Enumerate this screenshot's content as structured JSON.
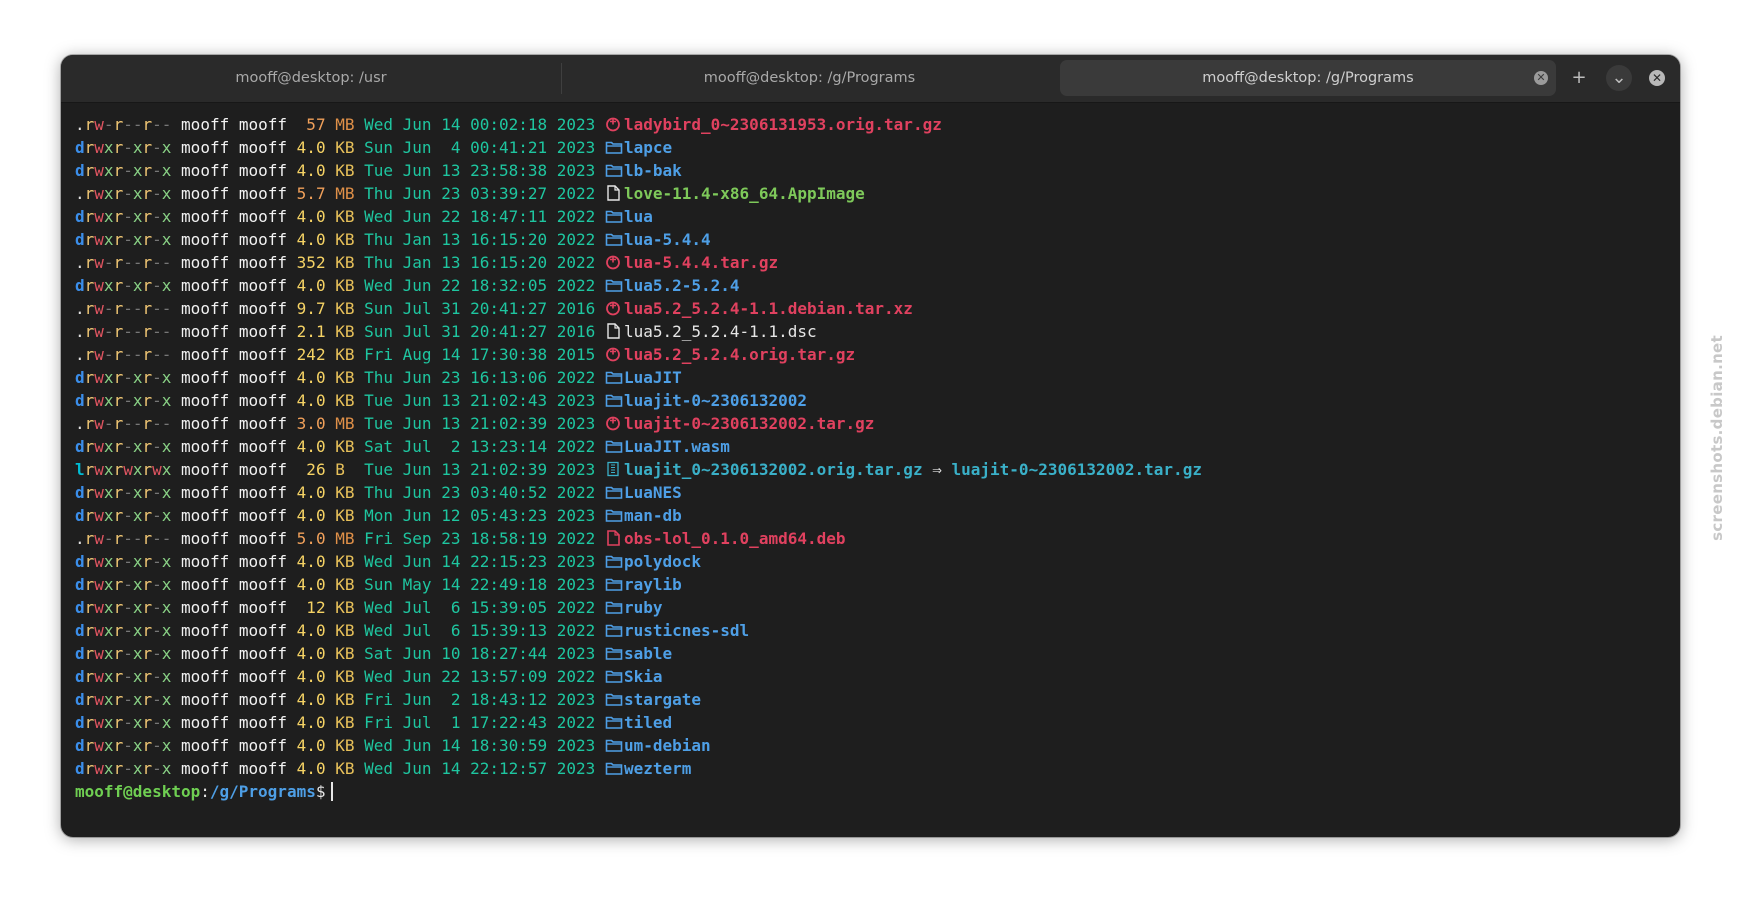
{
  "tabs": [
    {
      "label": "mooff@desktop: /usr"
    },
    {
      "label": "mooff@desktop: /g/Programs"
    },
    {
      "label": "mooff@desktop: /g/Programs"
    }
  ],
  "controls": {
    "add": "+",
    "menu": "⌄",
    "close": "✕",
    "tab_close": "✕"
  },
  "entries": [
    {
      "perm": ".rw-r--r--",
      "user": "mooff",
      "group": "mooff",
      "size": "57",
      "unit": "MB",
      "date": "Wed Jun 14 00:02:18 2023",
      "icon": "archive-icon",
      "name": "ladybird_0~2306131953.orig.tar.gz",
      "kind": "arch"
    },
    {
      "perm": "drwxr-xr-x",
      "user": "mooff",
      "group": "mooff",
      "size": "4.0",
      "unit": "KB",
      "date": "Sun Jun  4 00:41:21 2023",
      "icon": "folder-icon",
      "name": "lapce",
      "kind": "dir"
    },
    {
      "perm": "drwxr-xr-x",
      "user": "mooff",
      "group": "mooff",
      "size": "4.0",
      "unit": "KB",
      "date": "Tue Jun 13 23:58:38 2023",
      "icon": "folder-icon",
      "name": "lb-bak",
      "kind": "dir"
    },
    {
      "perm": ".rwxr-xr-x",
      "user": "mooff",
      "group": "mooff",
      "size": "5.7",
      "unit": "MB",
      "date": "Thu Jun 23 03:39:27 2022",
      "icon": "file-icon",
      "name": "love-11.4-x86_64.AppImage",
      "kind": "exec"
    },
    {
      "perm": "drwxr-xr-x",
      "user": "mooff",
      "group": "mooff",
      "size": "4.0",
      "unit": "KB",
      "date": "Wed Jun 22 18:47:11 2022",
      "icon": "folder-icon",
      "name": "lua",
      "kind": "dir"
    },
    {
      "perm": "drwxr-xr-x",
      "user": "mooff",
      "group": "mooff",
      "size": "4.0",
      "unit": "KB",
      "date": "Thu Jan 13 16:15:20 2022",
      "icon": "folder-icon",
      "name": "lua-5.4.4",
      "kind": "dir"
    },
    {
      "perm": ".rw-r--r--",
      "user": "mooff",
      "group": "mooff",
      "size": "352",
      "unit": "KB",
      "date": "Thu Jan 13 16:15:20 2022",
      "icon": "archive-icon",
      "name": "lua-5.4.4.tar.gz",
      "kind": "arch"
    },
    {
      "perm": "drwxr-xr-x",
      "user": "mooff",
      "group": "mooff",
      "size": "4.0",
      "unit": "KB",
      "date": "Wed Jun 22 18:32:05 2022",
      "icon": "folder-icon",
      "name": "lua5.2-5.2.4",
      "kind": "dir"
    },
    {
      "perm": ".rw-r--r--",
      "user": "mooff",
      "group": "mooff",
      "size": "9.7",
      "unit": "KB",
      "date": "Sun Jul 31 20:41:27 2016",
      "icon": "archive-icon",
      "name": "lua5.2_5.2.4-1.1.debian.tar.xz",
      "kind": "arch"
    },
    {
      "perm": ".rw-r--r--",
      "user": "mooff",
      "group": "mooff",
      "size": "2.1",
      "unit": "KB",
      "date": "Sun Jul 31 20:41:27 2016",
      "icon": "file-icon",
      "name": "lua5.2_5.2.4-1.1.dsc",
      "kind": "file"
    },
    {
      "perm": ".rw-r--r--",
      "user": "mooff",
      "group": "mooff",
      "size": "242",
      "unit": "KB",
      "date": "Fri Aug 14 17:30:38 2015",
      "icon": "archive-icon",
      "name": "lua5.2_5.2.4.orig.tar.gz",
      "kind": "arch"
    },
    {
      "perm": "drwxr-xr-x",
      "user": "mooff",
      "group": "mooff",
      "size": "4.0",
      "unit": "KB",
      "date": "Thu Jun 23 16:13:06 2022",
      "icon": "folder-icon",
      "name": "LuaJIT",
      "kind": "dir"
    },
    {
      "perm": "drwxr-xr-x",
      "user": "mooff",
      "group": "mooff",
      "size": "4.0",
      "unit": "KB",
      "date": "Tue Jun 13 21:02:43 2023",
      "icon": "folder-icon",
      "name": "luajit-0~2306132002",
      "kind": "dir"
    },
    {
      "perm": ".rw-r--r--",
      "user": "mooff",
      "group": "mooff",
      "size": "3.0",
      "unit": "MB",
      "date": "Tue Jun 13 21:02:39 2023",
      "icon": "archive-icon",
      "name": "luajit-0~2306132002.tar.gz",
      "kind": "arch"
    },
    {
      "perm": "drwxr-xr-x",
      "user": "mooff",
      "group": "mooff",
      "size": "4.0",
      "unit": "KB",
      "date": "Sat Jul  2 13:23:14 2022",
      "icon": "folder-icon",
      "name": "LuaJIT.wasm",
      "kind": "dir"
    },
    {
      "perm": "lrwxrwxrwx",
      "user": "mooff",
      "group": "mooff",
      "size": "26",
      "unit": "B ",
      "date": "Tue Jun 13 21:02:39 2023",
      "icon": "link-icon",
      "name": "luajit_0~2306132002.orig.tar.gz",
      "kind": "link",
      "arrow": "⇒",
      "target": "luajit-0~2306132002.tar.gz"
    },
    {
      "perm": "drwxr-xr-x",
      "user": "mooff",
      "group": "mooff",
      "size": "4.0",
      "unit": "KB",
      "date": "Thu Jun 23 03:40:52 2022",
      "icon": "folder-icon",
      "name": "LuaNES",
      "kind": "dir"
    },
    {
      "perm": "drwxr-xr-x",
      "user": "mooff",
      "group": "mooff",
      "size": "4.0",
      "unit": "KB",
      "date": "Mon Jun 12 05:43:23 2023",
      "icon": "folder-icon",
      "name": "man-db",
      "kind": "dir"
    },
    {
      "perm": ".rw-r--r--",
      "user": "mooff",
      "group": "mooff",
      "size": "5.0",
      "unit": "MB",
      "date": "Fri Sep 23 18:58:19 2022",
      "icon": "deb-icon",
      "name": "obs-lol_0.1.0_amd64.deb",
      "kind": "deb"
    },
    {
      "perm": "drwxr-xr-x",
      "user": "mooff",
      "group": "mooff",
      "size": "4.0",
      "unit": "KB",
      "date": "Wed Jun 14 22:15:23 2023",
      "icon": "folder-icon",
      "name": "polydock",
      "kind": "dir"
    },
    {
      "perm": "drwxr-xr-x",
      "user": "mooff",
      "group": "mooff",
      "size": "4.0",
      "unit": "KB",
      "date": "Sun May 14 22:49:18 2023",
      "icon": "folder-icon",
      "name": "raylib",
      "kind": "dir"
    },
    {
      "perm": "drwxr-xr-x",
      "user": "mooff",
      "group": "mooff",
      "size": "12",
      "unit": "KB",
      "date": "Wed Jul  6 15:39:05 2022",
      "icon": "folder-icon",
      "name": "ruby",
      "kind": "dir"
    },
    {
      "perm": "drwxr-xr-x",
      "user": "mooff",
      "group": "mooff",
      "size": "4.0",
      "unit": "KB",
      "date": "Wed Jul  6 15:39:13 2022",
      "icon": "folder-icon",
      "name": "rusticnes-sdl",
      "kind": "dir"
    },
    {
      "perm": "drwxr-xr-x",
      "user": "mooff",
      "group": "mooff",
      "size": "4.0",
      "unit": "KB",
      "date": "Sat Jun 10 18:27:44 2023",
      "icon": "folder-icon",
      "name": "sable",
      "kind": "dir"
    },
    {
      "perm": "drwxr-xr-x",
      "user": "mooff",
      "group": "mooff",
      "size": "4.0",
      "unit": "KB",
      "date": "Wed Jun 22 13:57:09 2022",
      "icon": "folder-icon",
      "name": "Skia",
      "kind": "dir"
    },
    {
      "perm": "drwxr-xr-x",
      "user": "mooff",
      "group": "mooff",
      "size": "4.0",
      "unit": "KB",
      "date": "Fri Jun  2 18:43:12 2023",
      "icon": "folder-icon",
      "name": "stargate",
      "kind": "dir"
    },
    {
      "perm": "drwxr-xr-x",
      "user": "mooff",
      "group": "mooff",
      "size": "4.0",
      "unit": "KB",
      "date": "Fri Jul  1 17:22:43 2022",
      "icon": "folder-icon",
      "name": "tiled",
      "kind": "dir"
    },
    {
      "perm": "drwxr-xr-x",
      "user": "mooff",
      "group": "mooff",
      "size": "4.0",
      "unit": "KB",
      "date": "Wed Jun 14 18:30:59 2023",
      "icon": "folder-icon",
      "name": "um-debian",
      "kind": "dir"
    },
    {
      "perm": "drwxr-xr-x",
      "user": "mooff",
      "group": "mooff",
      "size": "4.0",
      "unit": "KB",
      "date": "Wed Jun 14 22:12:57 2023",
      "icon": "folder-icon",
      "name": "wezterm",
      "kind": "dir"
    }
  ],
  "prompt": {
    "user": "mooff@desktop",
    "sep": ":",
    "path": "/g/Programs",
    "dollar": "$"
  },
  "watermark": "screenshots.debian.net",
  "colors": {
    "dir": "#4e9fe6",
    "archive": "#e0415f",
    "exec": "#7ec95a",
    "link": "#3ab0c8",
    "date": "#1ec6a0",
    "size": "#f6d365",
    "prompt_user": "#6fcf52"
  }
}
